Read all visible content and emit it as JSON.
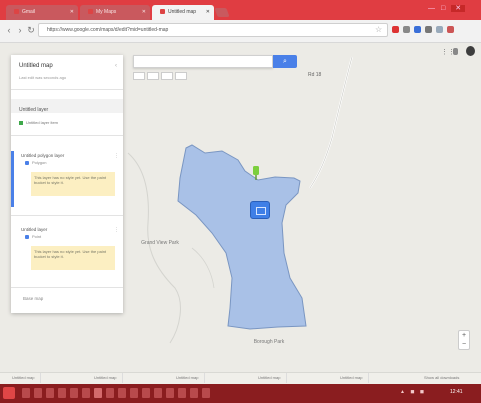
{
  "browser": {
    "tabs": [
      {
        "label": "Gmail",
        "active": false
      },
      {
        "label": "My Maps",
        "active": false
      },
      {
        "label": "Untitled map",
        "active": true
      }
    ],
    "new_tab_icon": "plus-icon",
    "url": "https://www.google.com/maps/d/edit?mid=untitled-map",
    "window_controls": {
      "minimize": "—",
      "maximize": "□",
      "close": "✕"
    }
  },
  "map": {
    "search_placeholder": "",
    "search_button_icon": "search-icon",
    "road_label": "Rd 18",
    "center_label": "Borough Park",
    "left_place_label": "Grand View Park",
    "zoom_in": "+",
    "zoom_out": "−"
  },
  "panel": {
    "title": "Untitled map",
    "subtitle": "Last edit was seconds ago",
    "base_layer_label": "Untitled layer",
    "base_layer_item": "Untitled layer item",
    "layers": [
      {
        "title": "Untitled polygon layer",
        "item": "Polygon",
        "note": "This layer has no style yet. Use the paint bucket to style it."
      },
      {
        "title": "Untitled layer",
        "item": "Point",
        "note": "This layer has no style yet. Use the paint bucket to style it."
      }
    ],
    "footer": "Base map"
  },
  "bottom_tabs": [
    "Untitled map",
    "Untitled map",
    "Untitled map",
    "Untitled map",
    "Untitled map"
  ],
  "bottom_tabs_right": "Show all downloads",
  "taskbar": {
    "clock": "12:41",
    "tray": "▲ ◼ ◼"
  },
  "colors": {
    "tabbar": "#e03d42",
    "polygon_fill": "#a9c1e7",
    "polygon_stroke": "#7a96c2",
    "accent": "#4a80e8",
    "taskbar": "#8a1d1f"
  }
}
